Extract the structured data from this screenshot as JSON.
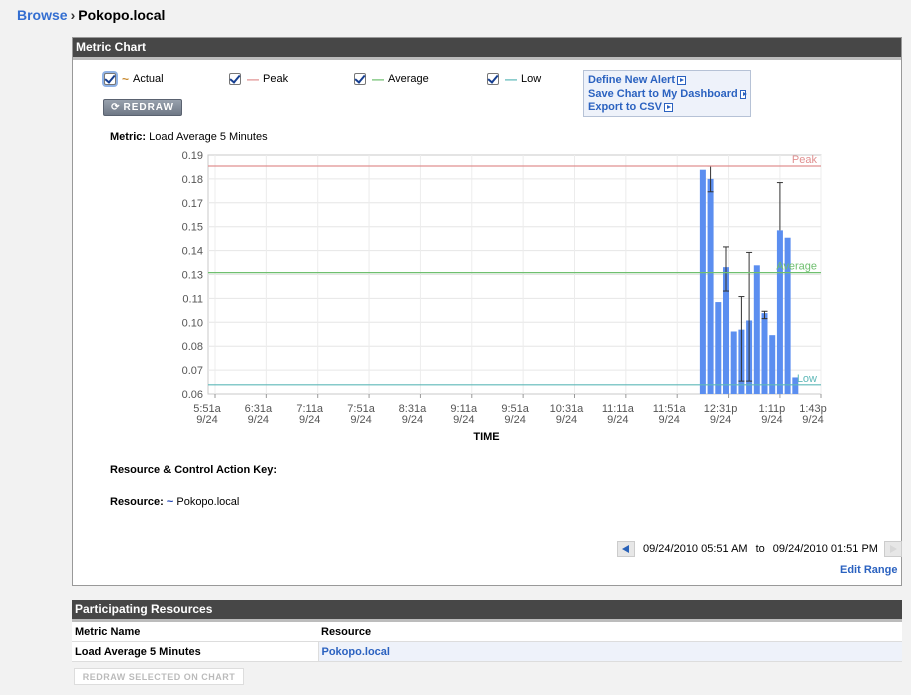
{
  "breadcrumb": {
    "parent": "Browse",
    "separator": "›",
    "current": "Pokopo.local"
  },
  "metric_chart": {
    "title": "Metric Chart",
    "legend": [
      {
        "label": "Actual",
        "symbol": "~",
        "color": "#c8892e"
      },
      {
        "label": "Peak",
        "symbol": "—",
        "color": "#e09090"
      },
      {
        "label": "Average",
        "symbol": "—",
        "color": "#6fbf6f"
      },
      {
        "label": "Low",
        "symbol": "—",
        "color": "#5eb8b8"
      }
    ],
    "redraw_label": "REDRAW",
    "actions": {
      "define_alert": "Define New Alert",
      "save_chart": "Save Chart to My Dashboard",
      "export_csv": "Export to CSV"
    },
    "metric_prefix": "Metric:",
    "metric_name": "Load Average 5 Minutes",
    "key_label": "Resource & Control Action Key:",
    "resource_prefix": "Resource:",
    "resource_symbol": "~",
    "resource_name": "Pokopo.local",
    "range": {
      "from": "09/24/2010 05:51 AM",
      "to_word": "to",
      "to": "09/24/2010 01:51 PM"
    },
    "edit_range": "Edit Range"
  },
  "chart_data": {
    "type": "bar",
    "xlabel": "TIME",
    "ylim": [
      0.06,
      0.19
    ],
    "y_ticks": [
      "0.19",
      "0.18",
      "0.17",
      "0.15",
      "0.14",
      "0.13",
      "0.11",
      "0.10",
      "0.08",
      "0.07",
      "0.06"
    ],
    "x_ticks": [
      {
        "time": "5:51a",
        "date": "9/24"
      },
      {
        "time": "6:31a",
        "date": "9/24"
      },
      {
        "time": "7:11a",
        "date": "9/24"
      },
      {
        "time": "7:51a",
        "date": "9/24"
      },
      {
        "time": "8:31a",
        "date": "9/24"
      },
      {
        "time": "9:11a",
        "date": "9/24"
      },
      {
        "time": "9:51a",
        "date": "9/24"
      },
      {
        "time": "10:31a",
        "date": "9/24"
      },
      {
        "time": "11:11a",
        "date": "9/24"
      },
      {
        "time": "11:51a",
        "date": "9/24"
      },
      {
        "time": "12:31p",
        "date": "9/24"
      },
      {
        "time": "1:11p",
        "date": "9/24"
      },
      {
        "time": "1:43p",
        "date": "9/24"
      }
    ],
    "lines": [
      {
        "name": "Peak",
        "value": 0.184,
        "color": "#e09090"
      },
      {
        "name": "Average",
        "value": 0.126,
        "color": "#6fbf6f"
      },
      {
        "name": "Low",
        "value": 0.065,
        "color": "#5eb8b8"
      }
    ],
    "bars": {
      "color": "#5b8ef0",
      "x": [
        "12:11p",
        "12:17p",
        "12:23p",
        "12:29p",
        "12:35p",
        "12:41p",
        "12:47p",
        "12:53p",
        "12:59p",
        "1:05p",
        "1:11p",
        "1:17p",
        "1:23p"
      ],
      "values": [
        0.182,
        0.177,
        0.11,
        0.129,
        0.094,
        0.095,
        0.1,
        0.13,
        0.104,
        0.092,
        0.149,
        0.145,
        0.069
      ],
      "error_high": [
        null,
        0.184,
        null,
        0.14,
        null,
        0.113,
        0.137,
        null,
        0.105,
        null,
        0.175,
        null,
        null
      ],
      "error_low": [
        null,
        0.17,
        null,
        0.116,
        null,
        0.067,
        0.067,
        null,
        0.101,
        null,
        null,
        null,
        null
      ]
    }
  },
  "participating": {
    "title": "Participating Resources",
    "columns": [
      "Metric Name",
      "Resource"
    ],
    "rows": [
      {
        "metric": "Load Average 5 Minutes",
        "resource": "Pokopo.local"
      }
    ],
    "redraw_selected": "REDRAW SELECTED ON CHART"
  }
}
